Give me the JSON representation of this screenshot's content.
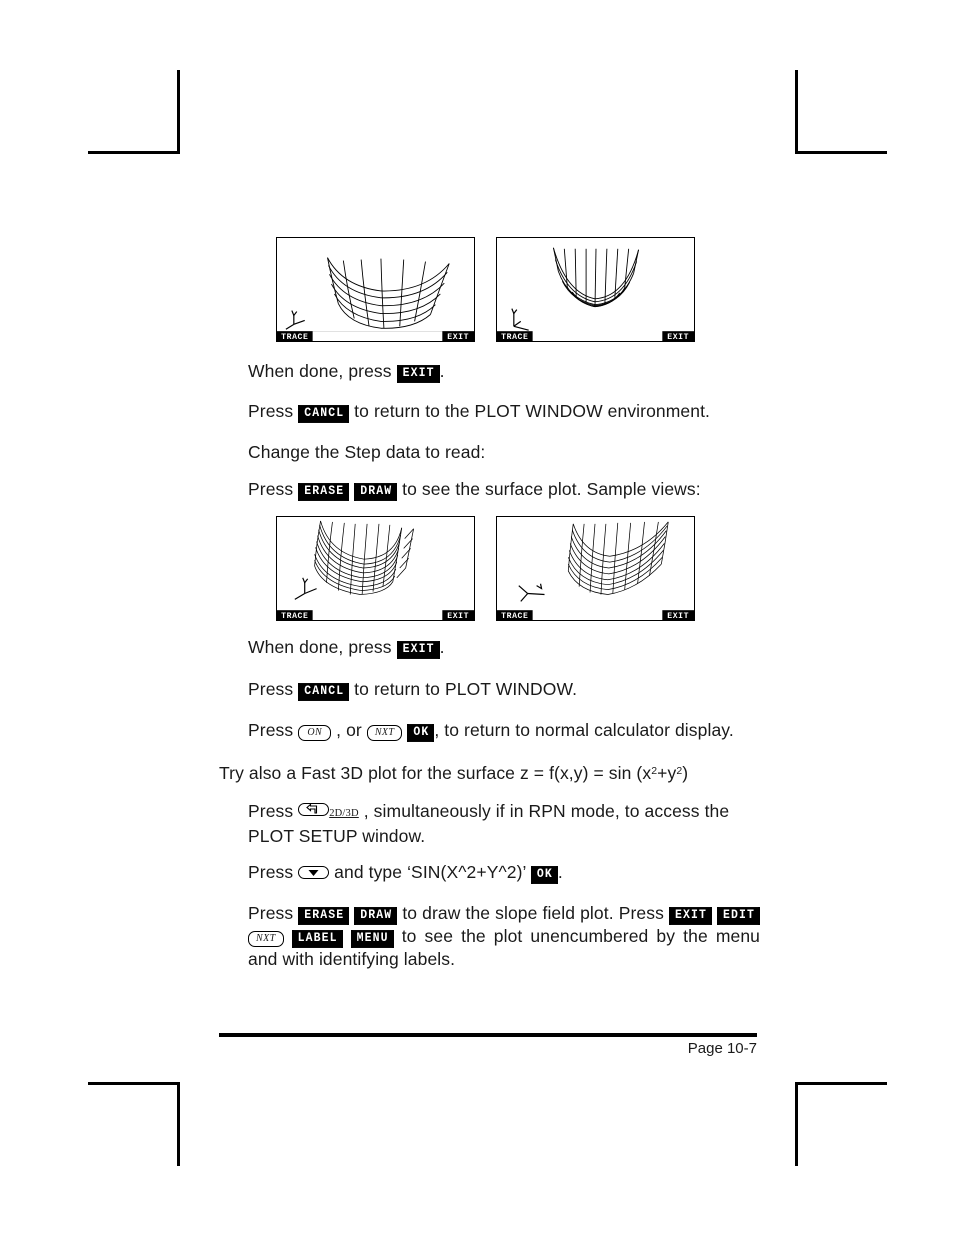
{
  "document": {
    "footer": {
      "page_label": "Page 10-7"
    }
  },
  "screens": {
    "row1": [
      {
        "name": "surface-plot-view-1",
        "trace_label": "TRACE",
        "exit_label": "EXIT"
      },
      {
        "name": "surface-plot-view-2",
        "trace_label": "TRACE",
        "exit_label": "EXIT"
      }
    ],
    "row2": [
      {
        "name": "surface-plot-view-3",
        "trace_label": "TRACE",
        "exit_label": "EXIT"
      },
      {
        "name": "surface-plot-view-4",
        "trace_label": "TRACE",
        "exit_label": "EXIT"
      }
    ]
  },
  "softkeys": {
    "exit": "EXIT",
    "cancl": "CANCL",
    "erase": "ERASE",
    "draw": "DRAW",
    "ok": "OK",
    "edit": "EDIT",
    "label": "LABEL",
    "menu": "MENU"
  },
  "keys": {
    "on": "ON",
    "nxt": "NXT",
    "nxt2": "NXT",
    "twod_threed": "2D/3D"
  },
  "paragraphs": {
    "p1_a": "When done, press ",
    "p1_b": ".",
    "p2_a": "Press ",
    "p2_b": " to return to the PLOT WINDOW environment.",
    "p3": "Change the Step data to read:",
    "p4_a": "Press ",
    "p4_mid": " ",
    "p4_b": " to see the surface plot.  Sample views:",
    "p5_a": "When done, press ",
    "p5_b": ".",
    "p6_a": "Press ",
    "p6_b": " to return to PLOT WINDOW.",
    "p7_a": "Press ",
    "p7_b": " , or ",
    "p7_c": " ",
    "p7_d": ", to return to normal calculator display.",
    "p8_a": "Try also a Fast 3D plot for the surface z = f(x,y) = sin (x",
    "p8_sup1": "2",
    "p8_b": "+y",
    "p8_sup2": "2",
    "p8_c": ")",
    "p9_a": "Press ",
    "p9_b": " ",
    "p9_c": " , simultaneously if in RPN mode, to access the PLOT SETUP window.",
    "p10_a": "Press ",
    "p10_b": " and type ‘SIN(X^2+Y^2)’ ",
    "p10_c": ".",
    "p11_a": "Press ",
    "p11_b": " ",
    "p11_c": " to draw the slope field plot.   Press  ",
    "p11_d": " ",
    "p11_e": " ",
    "p11_f": " ",
    "p11_g": " ",
    "p11_h": " to see the plot unencumbered by the menu and with identifying labels."
  }
}
